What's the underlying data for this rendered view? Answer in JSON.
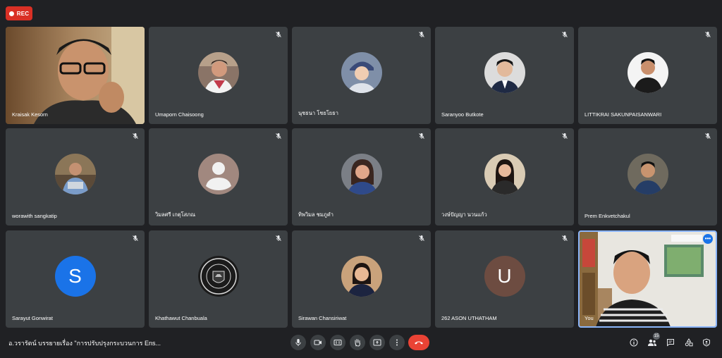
{
  "rec_label": "REC",
  "participants": [
    {
      "name": "Kraisak Kesorn",
      "type": "video"
    },
    {
      "name": "Umaporn Chaisoong",
      "type": "photo",
      "muted": true
    },
    {
      "name": "นุชธนา โชยโยธา",
      "type": "photo",
      "muted": true
    },
    {
      "name": "Saranyoo Butkote",
      "type": "photo",
      "muted": true
    },
    {
      "name": "LITTIKRAI SAKUNPAISANWARI",
      "type": "photo",
      "muted": true
    },
    {
      "name": "worawith sangkatip",
      "type": "photo",
      "muted": true
    },
    {
      "name": "วิมลศรี เกตุโสภณ",
      "type": "default",
      "muted": true
    },
    {
      "name": "ทิพวิมล ชมภูคำ",
      "type": "photo",
      "muted": true
    },
    {
      "name": "วงษ์ปัญญา นวนแก้ว",
      "type": "photo",
      "muted": true
    },
    {
      "name": "Prem Enkvetchakul",
      "type": "photo",
      "muted": true
    },
    {
      "name": "Sarayut Gonwirat",
      "type": "letter",
      "letter": "S",
      "color": "#1a73e8",
      "muted": true
    },
    {
      "name": "Khathawut Chanbuala",
      "type": "crest",
      "muted": true
    },
    {
      "name": "Sirawan Chansiriwat",
      "type": "photo",
      "muted": true
    },
    {
      "name": "262 ASON UTHATHAM",
      "type": "letter",
      "letter": "U",
      "color": "#6d4c41",
      "muted": true
    },
    {
      "name": "You",
      "type": "self-video"
    }
  ],
  "meeting_title": "อ.วรารัตน์ บรรยายเรื่อง \"การปรับปรุงกระบวนการ Ens...",
  "people_count": "15",
  "colors": {
    "end_call": "#ea4335",
    "rec": "#d93025",
    "active_border": "#8ab4f8"
  },
  "icons": {
    "controls": [
      "mic-icon",
      "camera-icon",
      "captions-icon",
      "raise-hand-icon",
      "present-icon",
      "more-options-icon",
      "end-call-icon"
    ],
    "side": [
      "info-icon",
      "people-icon",
      "chat-icon",
      "activities-icon",
      "host-controls-icon"
    ]
  }
}
